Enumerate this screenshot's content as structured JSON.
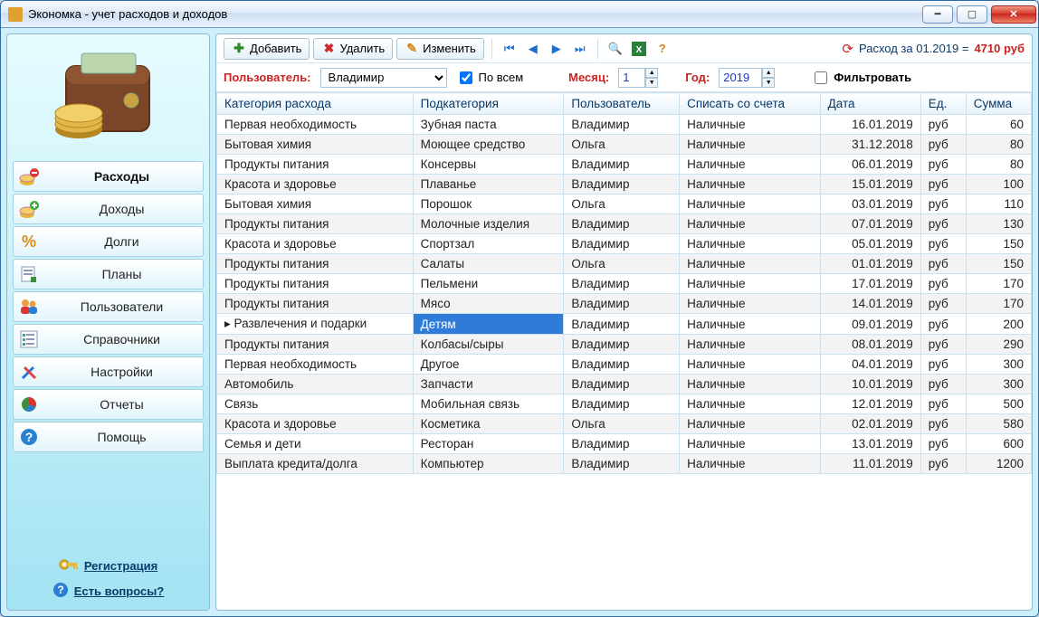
{
  "window": {
    "title": "Экономка - учет расходов и доходов"
  },
  "sidebar": {
    "items": [
      {
        "label": "Расходы"
      },
      {
        "label": "Доходы"
      },
      {
        "label": "Долги"
      },
      {
        "label": "Планы"
      },
      {
        "label": "Пользователи"
      },
      {
        "label": "Справочники"
      },
      {
        "label": "Настройки"
      },
      {
        "label": "Отчеты"
      },
      {
        "label": "Помощь"
      }
    ],
    "register": "Регистрация",
    "questions": "Есть вопросы?"
  },
  "toolbar": {
    "add": "Добавить",
    "delete": "Удалить",
    "edit": "Изменить",
    "summary": {
      "prefix": "Расход за 01.2019 =",
      "amount": "4710 руб"
    }
  },
  "filter": {
    "user_label": "Пользователь:",
    "user_value": "Владимир",
    "all_label": "По всем",
    "all_checked": true,
    "month_label": "Месяц:",
    "month_value": "1",
    "year_label": "Год:",
    "year_value": "2019",
    "filter_label": "Фильтровать",
    "filter_checked": false
  },
  "columns": {
    "cat": "Категория расхода",
    "subcat": "Подкатегория",
    "user": "Пользователь",
    "acct": "Списать со счета",
    "date": "Дата",
    "unit": "Ед.",
    "sum": "Сумма"
  },
  "rows": [
    {
      "cat": "Первая необходимость",
      "subcat": "Зубная паста",
      "user": "Владимир",
      "acct": "Наличные",
      "date": "16.01.2019",
      "unit": "руб",
      "sum": "60"
    },
    {
      "cat": "Бытовая химия",
      "subcat": "Моющее средство",
      "user": "Ольга",
      "acct": "Наличные",
      "date": "31.12.2018",
      "unit": "руб",
      "sum": "80"
    },
    {
      "cat": "Продукты питания",
      "subcat": "Консервы",
      "user": "Владимир",
      "acct": "Наличные",
      "date": "06.01.2019",
      "unit": "руб",
      "sum": "80"
    },
    {
      "cat": "Красота и здоровье",
      "subcat": "Плаванье",
      "user": "Владимир",
      "acct": "Наличные",
      "date": "15.01.2019",
      "unit": "руб",
      "sum": "100"
    },
    {
      "cat": "Бытовая химия",
      "subcat": "Порошок",
      "user": "Ольга",
      "acct": "Наличные",
      "date": "03.01.2019",
      "unit": "руб",
      "sum": "110"
    },
    {
      "cat": "Продукты питания",
      "subcat": "Молочные изделия",
      "user": "Владимир",
      "acct": "Наличные",
      "date": "07.01.2019",
      "unit": "руб",
      "sum": "130"
    },
    {
      "cat": "Красота и здоровье",
      "subcat": "Спортзал",
      "user": "Владимир",
      "acct": "Наличные",
      "date": "05.01.2019",
      "unit": "руб",
      "sum": "150"
    },
    {
      "cat": "Продукты питания",
      "subcat": "Салаты",
      "user": "Ольга",
      "acct": "Наличные",
      "date": "01.01.2019",
      "unit": "руб",
      "sum": "150"
    },
    {
      "cat": "Продукты питания",
      "subcat": "Пельмени",
      "user": "Владимир",
      "acct": "Наличные",
      "date": "17.01.2019",
      "unit": "руб",
      "sum": "170"
    },
    {
      "cat": "Продукты питания",
      "subcat": "Мясо",
      "user": "Владимир",
      "acct": "Наличные",
      "date": "14.01.2019",
      "unit": "руб",
      "sum": "170"
    },
    {
      "cat": "Развлечения и подарки",
      "subcat": "Детям",
      "user": "Владимир",
      "acct": "Наличные",
      "date": "09.01.2019",
      "unit": "руб",
      "sum": "200",
      "selected": true
    },
    {
      "cat": "Продукты питания",
      "subcat": "Колбасы/сыры",
      "user": "Владимир",
      "acct": "Наличные",
      "date": "08.01.2019",
      "unit": "руб",
      "sum": "290"
    },
    {
      "cat": "Первая необходимость",
      "subcat": "Другое",
      "user": "Владимир",
      "acct": "Наличные",
      "date": "04.01.2019",
      "unit": "руб",
      "sum": "300"
    },
    {
      "cat": "Автомобиль",
      "subcat": "Запчасти",
      "user": "Владимир",
      "acct": "Наличные",
      "date": "10.01.2019",
      "unit": "руб",
      "sum": "300"
    },
    {
      "cat": "Связь",
      "subcat": "Мобильная связь",
      "user": "Владимир",
      "acct": "Наличные",
      "date": "12.01.2019",
      "unit": "руб",
      "sum": "500"
    },
    {
      "cat": "Красота и здоровье",
      "subcat": "Косметика",
      "user": "Ольга",
      "acct": "Наличные",
      "date": "02.01.2019",
      "unit": "руб",
      "sum": "580"
    },
    {
      "cat": "Семья и дети",
      "subcat": "Ресторан",
      "user": "Владимир",
      "acct": "Наличные",
      "date": "13.01.2019",
      "unit": "руб",
      "sum": "600"
    },
    {
      "cat": "Выплата кредита/долга",
      "subcat": "Компьютер",
      "user": "Владимир",
      "acct": "Наличные",
      "date": "11.01.2019",
      "unit": "руб",
      "sum": "1200"
    }
  ]
}
